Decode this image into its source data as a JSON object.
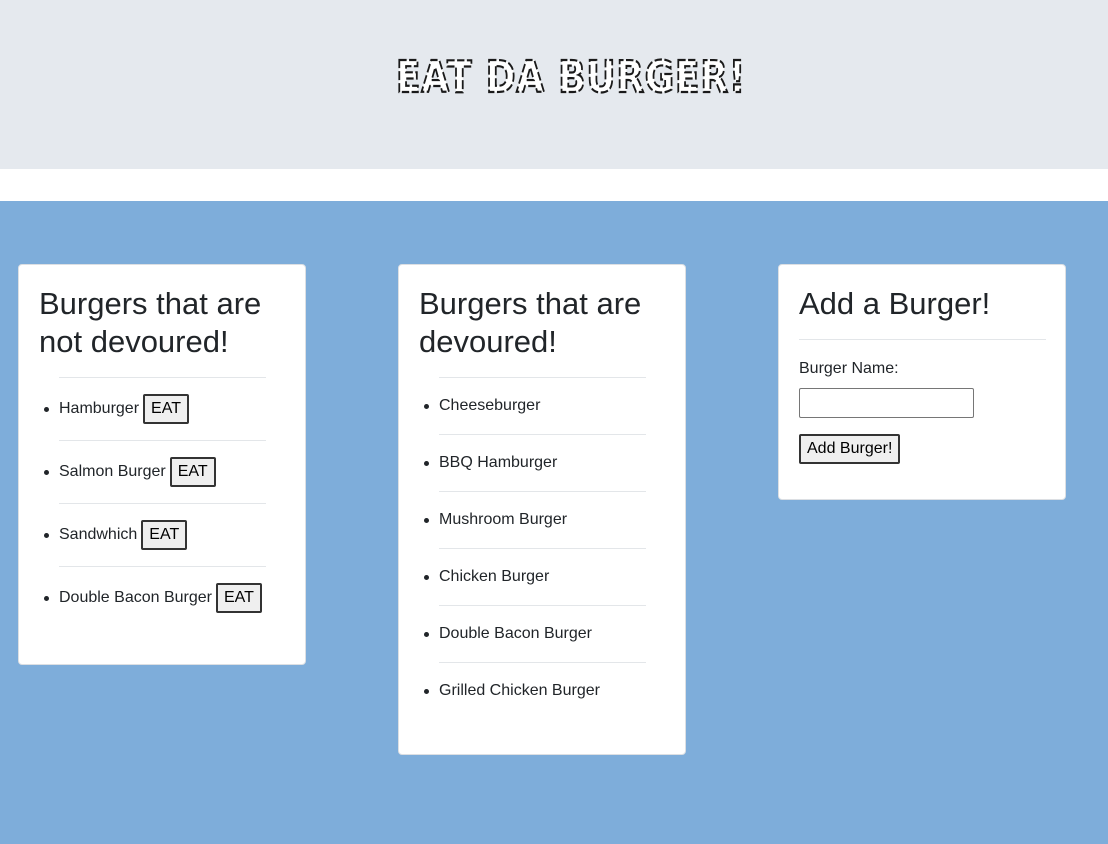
{
  "header": {
    "title": "EAT DA BURGER!",
    "background": "#e5e9ee"
  },
  "main": {
    "background": "#7eadda"
  },
  "not_devoured": {
    "heading": "Burgers that are not devoured!",
    "button_label": "EAT",
    "items": [
      {
        "name": "Hamburger"
      },
      {
        "name": "Salmon Burger"
      },
      {
        "name": "Sandwhich"
      },
      {
        "name": "Double Bacon Burger"
      }
    ]
  },
  "devoured": {
    "heading": "Burgers that are devoured!",
    "items": [
      {
        "name": "Cheeseburger"
      },
      {
        "name": "BBQ Hamburger"
      },
      {
        "name": "Mushroom Burger"
      },
      {
        "name": "Chicken Burger"
      },
      {
        "name": "Double Bacon Burger"
      },
      {
        "name": "Grilled Chicken Burger"
      }
    ]
  },
  "add_form": {
    "heading": "Add a Burger!",
    "label": "Burger Name:",
    "input_value": "",
    "button_label": "Add Burger!"
  }
}
